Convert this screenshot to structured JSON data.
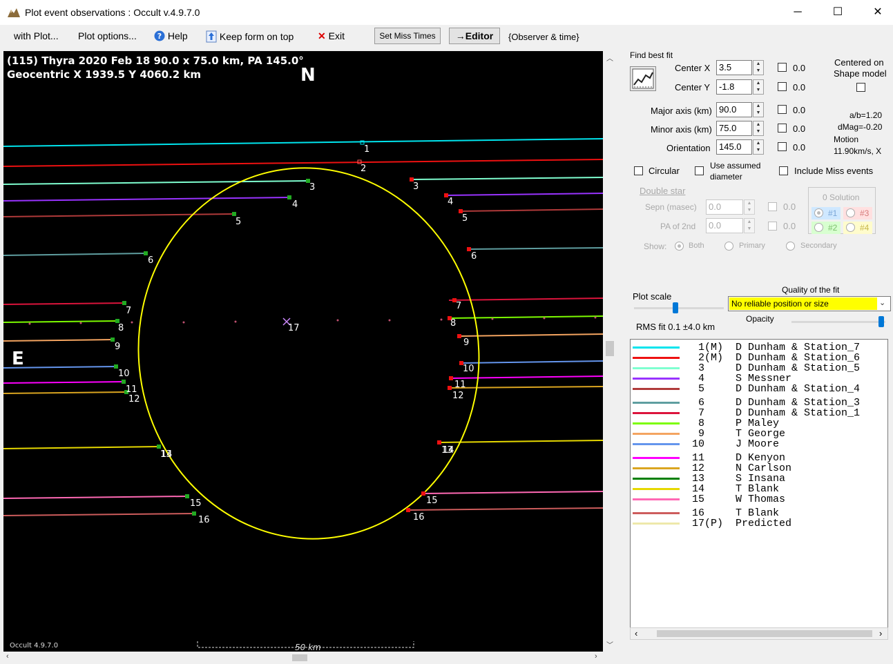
{
  "window": {
    "title": "Plot event observations : Occult v.4.9.7.0",
    "minimize": "─",
    "maximize": "☐",
    "close": "✕"
  },
  "menu": {
    "with_plot": "with Plot...",
    "plot_options": "Plot options...",
    "help": "Help",
    "keep_on_top": "Keep form on top",
    "exit": "Exit",
    "set_miss_times": "Set Miss Times",
    "editor": "→Editor",
    "observer_time": "{Observer & time}"
  },
  "plot": {
    "header_line1": "(115) Thyra  2020 Feb 18   90.0 x 75.0 km,  PA 145.0°",
    "header_line2": "Geocentric  X  1939.5  Y 4060.2 km",
    "north": "N",
    "east": "E",
    "footer_version": "Occult 4.9.7.0",
    "scale_label": "50 km",
    "center_label": "17"
  },
  "fit": {
    "find_best_fit": "Find best fit",
    "center_x_label": "Center X",
    "center_x": "3.5",
    "center_x_chk": "0.0",
    "center_y_label": "Center Y",
    "center_y": "-1.8",
    "center_y_chk": "0.0",
    "major_label": "Major axis (km)",
    "major": "90.0",
    "major_chk": "0.0",
    "minor_label": "Minor axis (km)",
    "minor": "75.0",
    "minor_chk": "0.0",
    "orient_label": "Orientation",
    "orient": "145.0",
    "orient_chk": "0.0",
    "centered_line1": "Centered on",
    "centered_line2": "Shape model",
    "ab_ratio": "a/b=1.20",
    "dmag": "dMag=-0.20",
    "motion_label": "Motion",
    "motion_value": "11.90km/s, X",
    "circular": "Circular",
    "use_assumed_line1": "Use assumed",
    "use_assumed_line2": "diameter",
    "include_miss": "Include Miss events"
  },
  "double_star": {
    "title": "Double star",
    "sepn_label": "Sepn (masec)",
    "sepn": "0.0",
    "sepn_chk": "0.0",
    "pa_label": "PA of 2nd",
    "pa": "0.0",
    "pa_chk": "0.0",
    "show_label": "Show:",
    "both": "Both",
    "primary": "Primary",
    "secondary": "Secondary",
    "solution_title": "0 Solution",
    "sol1": "#1",
    "sol2": "#2",
    "sol3": "#3",
    "sol4": "#4"
  },
  "quality": {
    "plot_scale": "Plot scale",
    "quality_label": "Quality of the fit",
    "quality_value": "No reliable position or size",
    "opacity": "Opacity",
    "rms": "RMS fit  0.1 ±4.0 km"
  },
  "legend": [
    {
      "color": "#00e5ee",
      "text": "  1(M)  D Dunham & Station_7"
    },
    {
      "color": "#ee1111",
      "text": "  2(M)  D Dunham & Station_6"
    },
    {
      "color": "#7fffd0",
      "text": "  3     D Dunham & Station_5"
    },
    {
      "color": "#9933ff",
      "text": "  4     S Messner"
    },
    {
      "color": "#b03a3a",
      "text": "  5     D Dunham & Station_4"
    },
    {
      "color": "#5f9ea0",
      "text": "  6     D Dunham & Station_3"
    },
    {
      "color": "#dc143c",
      "text": "  7     D Dunham & Station_1"
    },
    {
      "color": "#7cfc00",
      "text": "  8     P Maley"
    },
    {
      "color": "#f4a460",
      "text": "  9     T George"
    },
    {
      "color": "#6495ed",
      "text": " 10     J Moore"
    },
    {
      "color": "#ff00ff",
      "text": " 11     D Kenyon"
    },
    {
      "color": "#daa520",
      "text": " 12     N Carlson"
    },
    {
      "color": "#008000",
      "text": " 13     S Insana"
    },
    {
      "color": "#e6d800",
      "text": " 14     T Blank"
    },
    {
      "color": "#ff69b4",
      "text": " 15     W Thomas"
    },
    {
      "color": "#cd5c5c",
      "text": " 16     T Blank"
    },
    {
      "color": "#eee8aa",
      "text": " 17(P)  Predicted"
    }
  ]
}
